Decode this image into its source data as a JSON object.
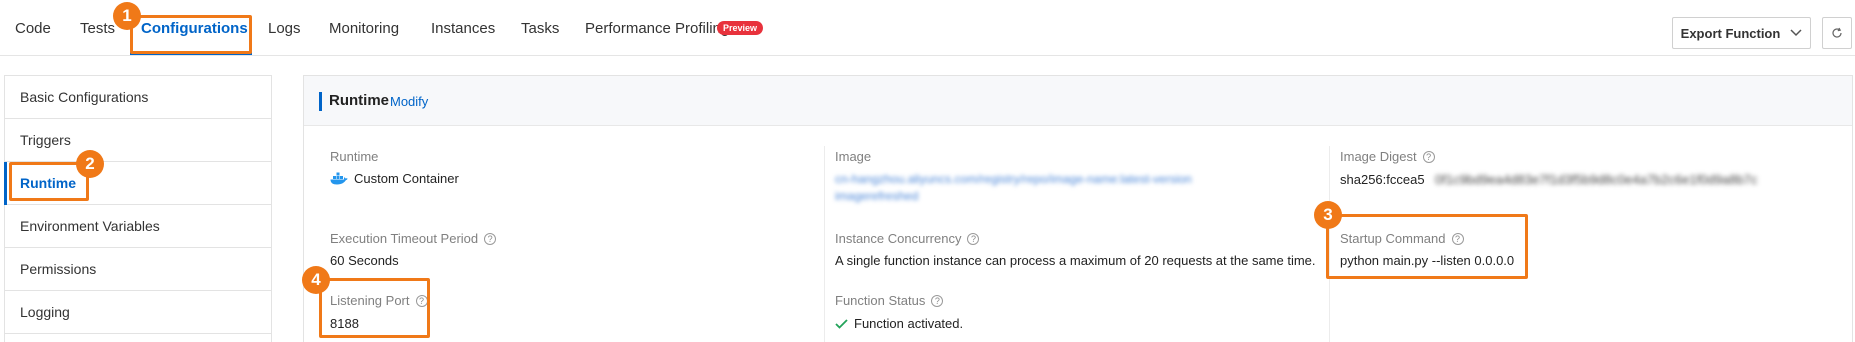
{
  "tabs": [
    {
      "label": "Code"
    },
    {
      "label": "Tests"
    },
    {
      "label": "Configurations"
    },
    {
      "label": "Logs"
    },
    {
      "label": "Monitoring"
    },
    {
      "label": "Instances"
    },
    {
      "label": "Tasks"
    },
    {
      "label": "Performance Profiling",
      "badge": "Preview"
    }
  ],
  "active_tab": "Configurations",
  "toolbar": {
    "export_label": "Export Function",
    "export_icon": "chevron-down-icon",
    "refresh_icon": "refresh-icon"
  },
  "sidebar": {
    "items": [
      {
        "label": "Basic Configurations"
      },
      {
        "label": "Triggers"
      },
      {
        "label": "Runtime"
      },
      {
        "label": "Environment Variables"
      },
      {
        "label": "Permissions"
      },
      {
        "label": "Logging"
      }
    ],
    "active": "Runtime"
  },
  "section": {
    "title": "Runtime",
    "action": "Modify"
  },
  "fields": {
    "runtime": {
      "label": "Runtime",
      "value": "Custom Container",
      "icon": "docker-icon"
    },
    "image": {
      "label": "Image",
      "value_line1": "cn-hangzhou.aliyuncs.com/registry/repo/image-name:latest-version",
      "value_line2": "imagerefreshed",
      "redacted": true
    },
    "image_digest": {
      "label": "Image Digest",
      "value_prefix": "sha256:fccea5",
      "value_redacted": "0f1c9bd9ea4d83e7f1d3f5b9d8c0e4a7b2c6e1f0d9a8b7c"
    },
    "execution_timeout": {
      "label": "Execution Timeout Period",
      "value": "60 Seconds"
    },
    "instance_concurrency": {
      "label": "Instance Concurrency",
      "value": "A single function instance can process a maximum of 20 requests at the same time."
    },
    "startup_command": {
      "label": "Startup Command",
      "value": "python main.py --listen 0.0.0.0"
    },
    "listening_port": {
      "label": "Listening Port",
      "value": "8188"
    },
    "function_status": {
      "label": "Function Status",
      "value": "Function activated.",
      "icon": "checkmark-icon"
    }
  },
  "callouts": [
    "1",
    "2",
    "3",
    "4"
  ],
  "colors": {
    "accent": "#0064c8",
    "callout": "#f07918",
    "success": "#23a35a",
    "badge": "#e8323c"
  }
}
